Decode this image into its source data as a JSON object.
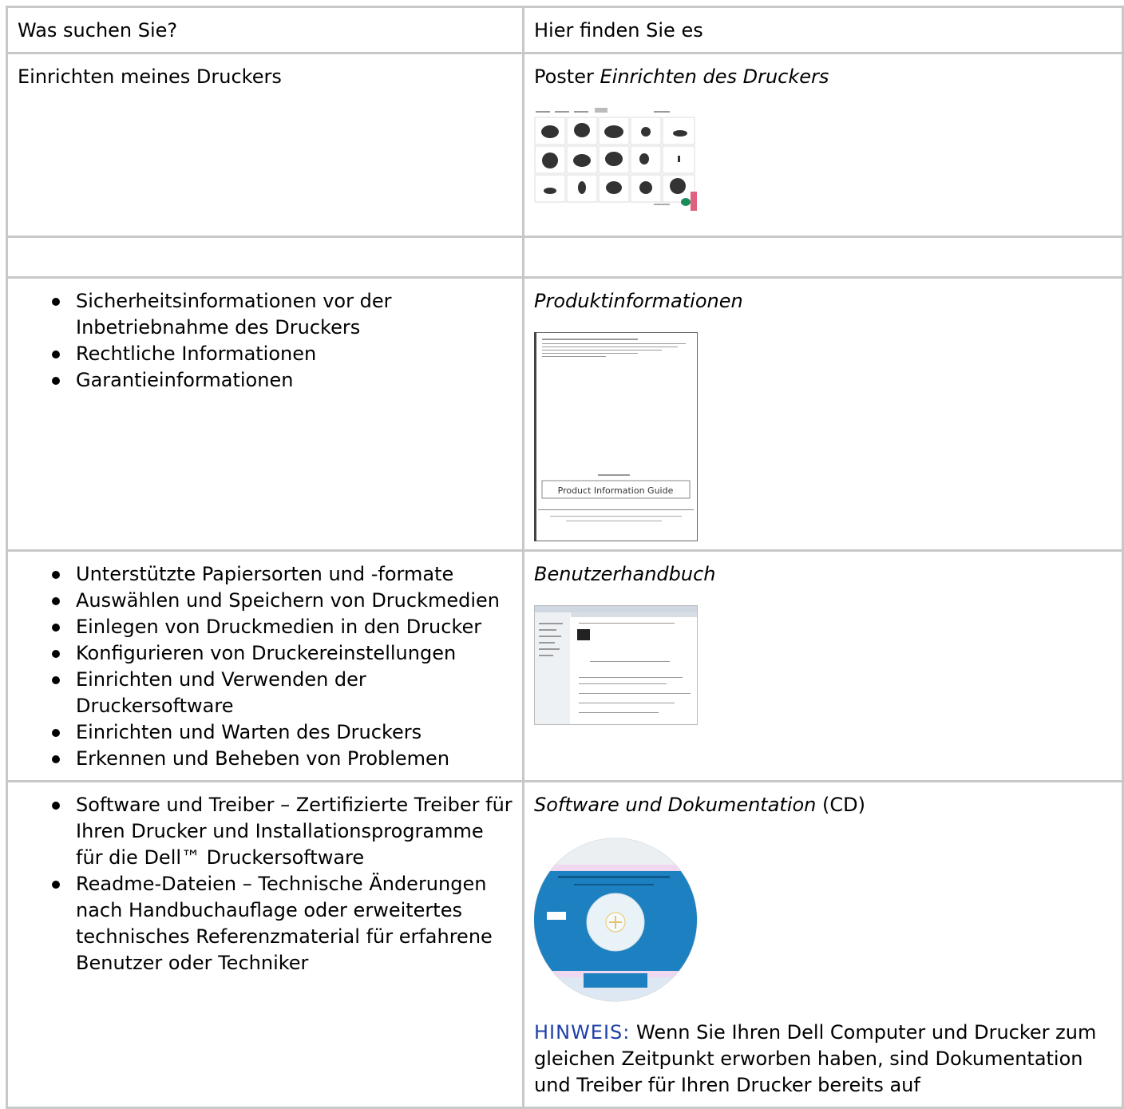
{
  "table": {
    "header": {
      "col1": "Was suchen Sie?",
      "col2": "Hier finden Sie es"
    },
    "rows": [
      {
        "left_text": "Einrichten meines Druckers",
        "right_prefix": "Poster ",
        "right_italic": "Einrichten des Druckers",
        "image_icon": "setup-poster-thumbnail"
      },
      {
        "left_text": "",
        "right_text": ""
      },
      {
        "left_items": [
          "Sicherheitsinformationen vor der Inbetriebnahme des Druckers",
          "Rechtliche Informationen",
          "Garantieinformationen"
        ],
        "right_italic": "Produktinformationen",
        "image_icon": "product-information-guide-thumbnail",
        "image_caption": "Product Information Guide"
      },
      {
        "left_items": [
          "Unterstützte Papiersorten und -formate",
          "Auswählen und Speichern von Druckmedien",
          "Einlegen von Druckmedien in den Drucker",
          "Konfigurieren von Druckereinstellungen",
          "Einrichten und Verwenden der Druckersoftware",
          "Einrichten und Warten des Druckers",
          "Erkennen und Beheben von Problemen"
        ],
        "right_italic": "Benutzerhandbuch",
        "image_icon": "user-guide-thumbnail"
      },
      {
        "left_items": [
          "Software und Treiber – Zertifizierte Treiber für Ihren Drucker und Installationsprogramme für die Dell™ Druckersoftware",
          "Readme-Dateien – Technische Änderungen nach Handbuchauflage oder erweitertes technisches Referenzmaterial für erfahrene Benutzer oder Techniker"
        ],
        "right_italic": "Software und Dokumentation",
        "right_suffix": " (CD)",
        "image_icon": "software-cd-thumbnail",
        "note_label": "HINWEIS:",
        "note_text": " Wenn Sie Ihren Dell Computer und Drucker zum gleichen Zeitpunkt erworben haben, sind Dokumentation und Treiber für Ihren Drucker bereits auf"
      }
    ]
  },
  "colors": {
    "border": "#c8c8c8",
    "note_label": "#1f3fa8",
    "cd_blue": "#1d80c0"
  }
}
